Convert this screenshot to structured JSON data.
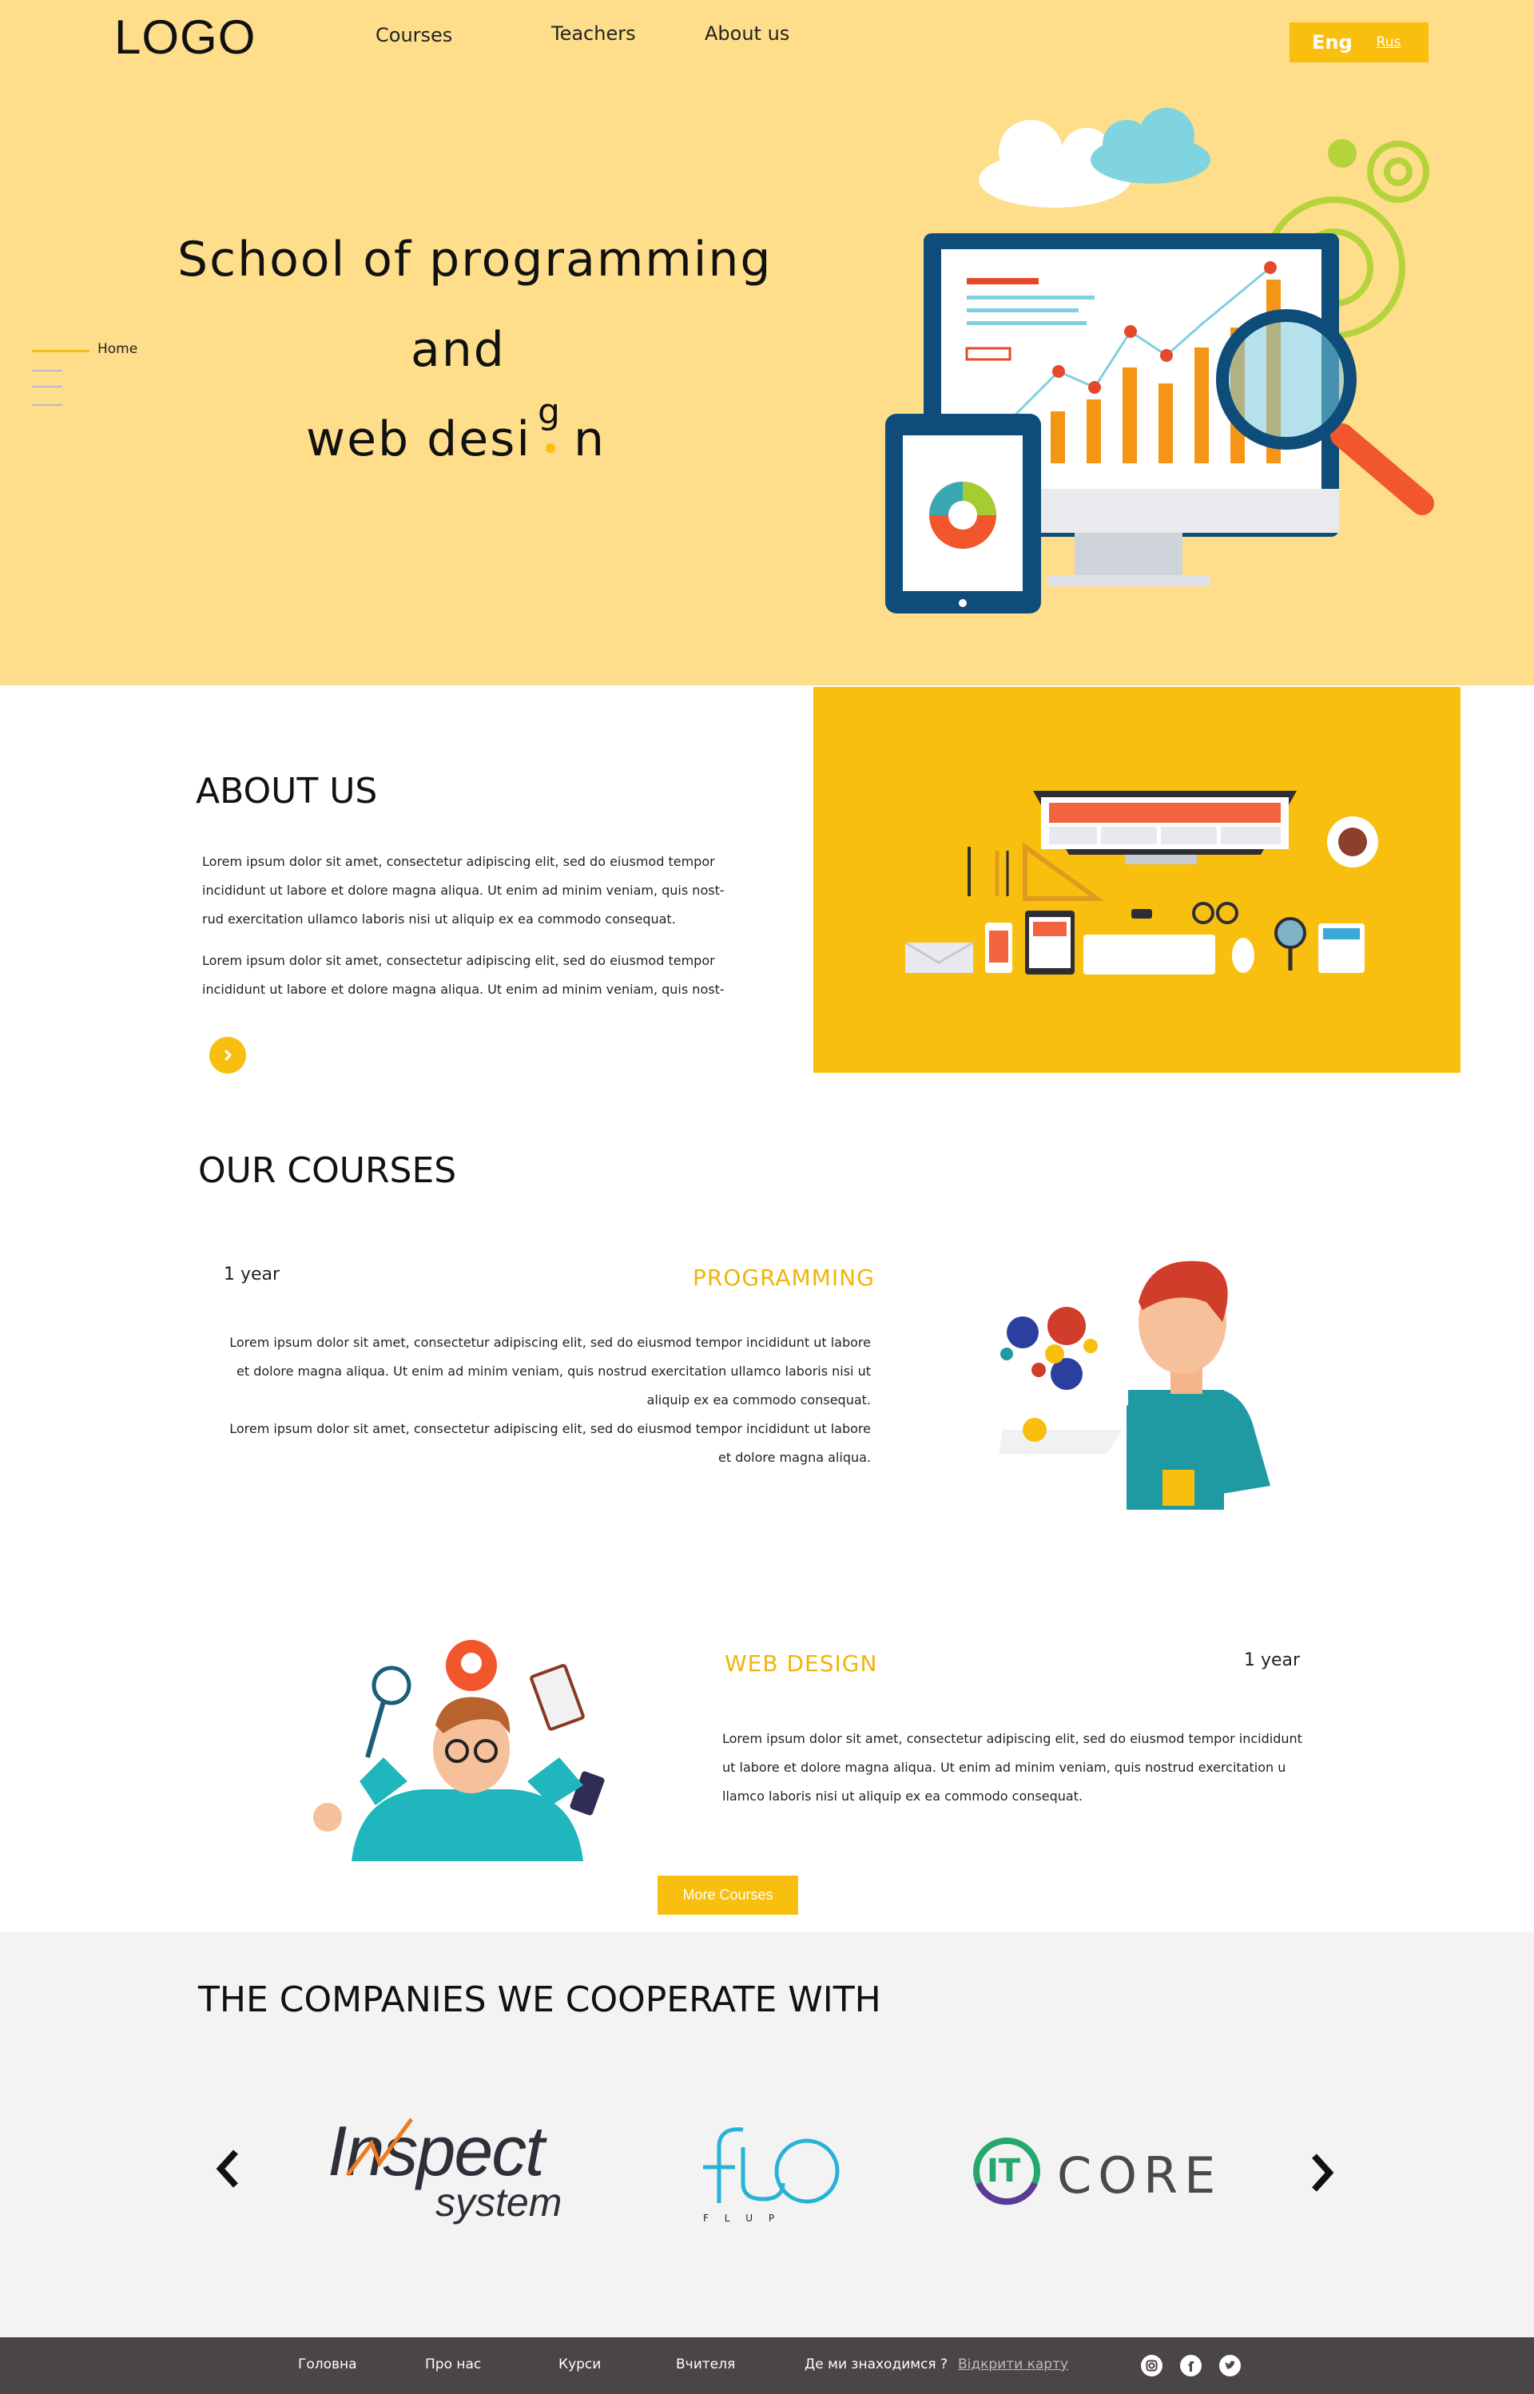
{
  "header": {
    "logo": "LOGO",
    "nav": [
      "Courses",
      "Teachers",
      "About us"
    ],
    "lang_eng": "Eng",
    "lang_rus": "Rus"
  },
  "hero": {
    "line1": "School of programming",
    "line2": "and",
    "line3": "web desi",
    "line3_g": "g",
    "line3_end": "n",
    "side_nav_home": "Home"
  },
  "about": {
    "title": "ABOUT  US",
    "para1": [
      "Lorem ipsum dolor sit amet, consectetur adipiscing elit, sed  do eiusmod tempor",
      "incididunt  ut labore  et dolore magna aliqua. Ut enim ad minim veniam, quis nost-",
      "rud exercitation ullamco laboris nisi ut  aliquip ex ea commodo consequat."
    ],
    "para2": [
      "Lorem ipsum dolor sit amet, consectetur adipiscing elit, sed  do eiusmod tempor",
      "incididunt  ut labore  et dolore magna aliqua. Ut enim ad minim veniam, quis nost-"
    ]
  },
  "courses": {
    "title": "OUR COURSES",
    "programming": {
      "year": "1 year",
      "name": "PROGRAMMING",
      "lines": [
        "Lorem ipsum dolor sit amet, consectetur adipiscing elit, sed  do eiusmod tempor incididunt ut labore",
        "et dolore magna aliqua. Ut enim ad minim veniam, quis nostrud exercitation ullamco laboris nisi ut",
        "aliquip ex ea commodo consequat.",
        "Lorem ipsum dolor sit amet, consectetur adipiscing elit, sed  do eiusmod tempor incididunt ut labore",
        "et dolore magna aliqua."
      ]
    },
    "webdesign": {
      "year": "1 year",
      "name": "WEB  DESIGN",
      "lines": [
        "Lorem ipsum dolor sit amet, consectetur adipiscing elit, sed  do eiusmod tempor incididunt",
        "ut labore  et dolore magna aliqua. Ut enim ad minim veniam, quis nostrud exercitation u",
        "llamco laboris nisi ut  aliquip ex ea commodo consequat."
      ]
    },
    "more_button": "More  Courses"
  },
  "companies": {
    "title": "THE COMPANIES WE COOPERATE WITH",
    "inspect_main": "Inspect",
    "inspect_sub": "system",
    "flup_sub": "F L U P",
    "itcore_it": "IT",
    "itcore_core": "CORE"
  },
  "footer": {
    "links": [
      "Головна",
      "Про нас",
      "Курси",
      "Вчителя"
    ],
    "where": "Де  ми  знаходимся ?",
    "map": "Відкрити карту"
  },
  "colors": {
    "accent": "#f8bf0f",
    "hero_bg": "#fede8a",
    "footer_bg": "#4a4546"
  }
}
